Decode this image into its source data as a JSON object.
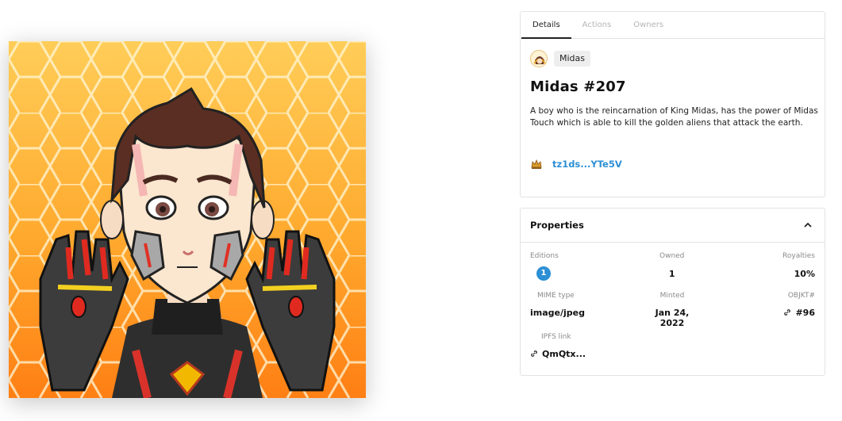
{
  "tabs": [
    {
      "label": "Details",
      "active": true
    },
    {
      "label": "Actions",
      "active": false
    },
    {
      "label": "Owners",
      "active": false
    }
  ],
  "collection": {
    "name": "Midas"
  },
  "token": {
    "title": "Midas #207",
    "description": "A boy who is the reincarnation of King Midas, has the power of Midas Touch which is able to kill the golden aliens that attack the earth."
  },
  "creator": {
    "address": "tz1ds...YTe5V",
    "avatar_icon": "crown-icon"
  },
  "properties": {
    "heading": "Properties",
    "editions_label": "Editions",
    "editions_value": "1",
    "owned_label": "Owned",
    "owned_value": "1",
    "royalties_label": "Royalties",
    "royalties_value": "10%",
    "mime_label": "MIME type",
    "mime_value": "image/jpeg",
    "minted_label": "Minted",
    "minted_value": "Jan 24, 2022",
    "objkt_label": "OBJKT#",
    "objkt_value": "#96",
    "ipfs_label": "IPFS link",
    "ipfs_value": "QmQtx..."
  },
  "colors": {
    "accent": "#2d8fd5",
    "art_bg_top": "#ffcc55",
    "art_bg_bottom": "#ff8a1a"
  }
}
